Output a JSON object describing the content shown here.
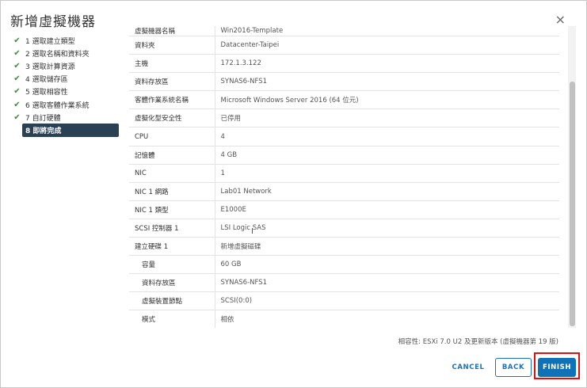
{
  "dialog": {
    "title": "新增虛擬機器",
    "close_glyph": "×"
  },
  "steps": [
    {
      "label": "1 選取建立類型",
      "done": true
    },
    {
      "label": "2 選取名稱和資料夾",
      "done": true
    },
    {
      "label": "3 選取計算資源",
      "done": true
    },
    {
      "label": "4 選取儲存區",
      "done": true
    },
    {
      "label": "5 選取相容性",
      "done": true
    },
    {
      "label": "6 選取客體作業系統",
      "done": true
    },
    {
      "label": "7 自訂硬體",
      "done": true
    },
    {
      "label": "8 即將完成",
      "done": false,
      "active": true
    }
  ],
  "check_glyph": "✔",
  "summary": [
    {
      "key": "虛擬機器名稱",
      "value": "Win2016-Template"
    },
    {
      "key": "資料夾",
      "value": "Datacenter-Taipei"
    },
    {
      "key": "主機",
      "value": "172.1.3.122"
    },
    {
      "key": "資料存放區",
      "value": "SYNAS6-NFS1"
    },
    {
      "key": "客體作業系統名稱",
      "value": "Microsoft Windows Server 2016 (64 位元)"
    },
    {
      "key": "虛擬化型安全性",
      "value": "已停用"
    },
    {
      "key": "CPU",
      "value": "4"
    },
    {
      "key": "記憶體",
      "value": "4 GB"
    },
    {
      "key": "NIC",
      "value": "1"
    },
    {
      "key": "NIC 1 網路",
      "value": "Lab01 Network"
    },
    {
      "key": "NIC 1 類型",
      "value": "E1000E"
    },
    {
      "key": "SCSI 控制器 1",
      "value": "LSI Logic SAS"
    },
    {
      "key": "建立硬碟 1",
      "value": "新增虛擬磁碟"
    },
    {
      "key": "容量",
      "value": "60 GB",
      "sub": true
    },
    {
      "key": "資料存放區",
      "value": "SYNAS6-NFS1",
      "sub": true
    },
    {
      "key": "虛擬裝置節點",
      "value": "SCSI(0:0)",
      "sub": true
    },
    {
      "key": "模式",
      "value": "相依",
      "sub": true
    }
  ],
  "compatibility": "相容性: ESXi 7.0 U2 及更新版本 (虛擬機器第 19 版)",
  "buttons": {
    "cancel": "CANCEL",
    "back": "BACK",
    "finish": "FINISH"
  },
  "colors": {
    "accent": "#0f72b6",
    "active_step": "#2b4052",
    "check": "#3b8a3b",
    "highlight": "#e01010"
  }
}
